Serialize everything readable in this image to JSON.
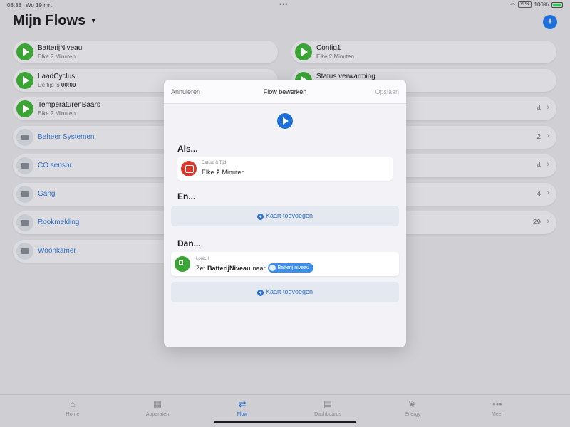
{
  "status_bar": {
    "time": "08:38",
    "date": "Wo 19 mrt",
    "vpn": "VPN",
    "battery": "100%"
  },
  "header": {
    "title": "Mijn Flows",
    "add_icon": "plus-icon"
  },
  "flows_left": [
    {
      "title": "BatterijNiveau",
      "subtitle": "Elke 2 Minuten"
    },
    {
      "title": "LaadCyclus",
      "subtitle_prefix": "De tijd is ",
      "subtitle_bold": "00:00"
    },
    {
      "title": "TemperaturenBaars",
      "subtitle": "Elke 2 Minuten"
    }
  ],
  "folders_left": [
    "Beheer Systemen",
    "CO sensor",
    "Gang",
    "Rookmelding",
    "Woonkamer"
  ],
  "flows_right": [
    {
      "title": "Config1",
      "subtitle": "Elke 2 Minuten"
    },
    {
      "title": "Status verwarming",
      "subtitle": ""
    }
  ],
  "right_counts": [
    "4",
    "2",
    "4",
    "4",
    "29"
  ],
  "modal": {
    "cancel": "Annuleren",
    "title": "Flow bewerken",
    "save": "Opslaan",
    "when_heading": "Als...",
    "when_card": {
      "label": "Datum & Tijd",
      "text_prefix": "Elke",
      "text_bold": "2",
      "text_suffix": "Minuten"
    },
    "and_heading": "En...",
    "add_card_1": "Kaart toevoegen",
    "then_heading": "Dan...",
    "then_card": {
      "label": "Logic",
      "text_prefix": "Zet",
      "text_bold": "BatterijNiveau",
      "text_mid": "naar",
      "pill": "Batterij niveau"
    },
    "add_card_2": "Kaart toevoegen"
  },
  "tabs": [
    {
      "label": "Home",
      "icon": "home-icon",
      "active": false
    },
    {
      "label": "Apparaten",
      "icon": "grid-icon",
      "active": false
    },
    {
      "label": "Flow",
      "icon": "shuffle-icon",
      "active": true
    },
    {
      "label": "Dashboards",
      "icon": "dashboard-icon",
      "active": false
    },
    {
      "label": "Energy",
      "icon": "leaf-icon",
      "active": false
    },
    {
      "label": "Meer",
      "icon": "more-icon",
      "active": false
    }
  ],
  "colors": {
    "accent": "#1e6fd9",
    "play_green": "#3aa435",
    "trigger_red": "#d63a2f",
    "folder_text": "#2f6fcb"
  }
}
